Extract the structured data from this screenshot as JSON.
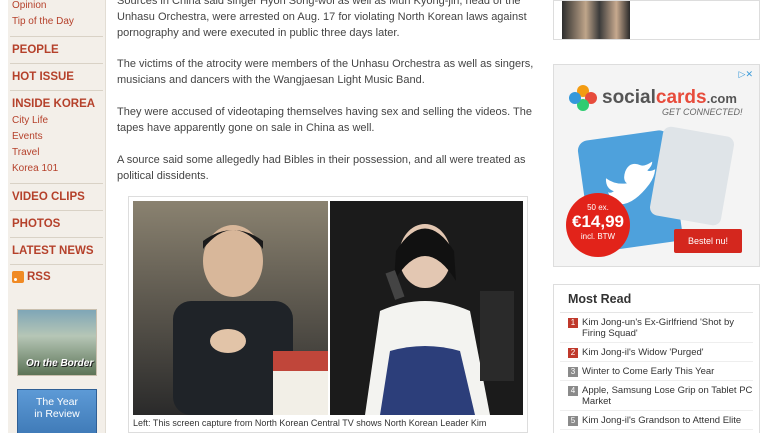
{
  "nav": {
    "top_links": [
      "Opinion",
      "Tip of the Day"
    ],
    "people": "PEOPLE",
    "hot_issue": "HOT ISSUE",
    "inside_korea": "INSIDE KOREA",
    "inside_korea_items": [
      "City Life",
      "Events",
      "Travel",
      "Korea 101"
    ],
    "video_clips": "VIDEO CLIPS",
    "photos": "PHOTOS",
    "latest_news": "LATEST NEWS",
    "rss": "RSS",
    "promo_border": "On the Border",
    "promo_year_line1": "The Year",
    "promo_year_line2": "in Review"
  },
  "article": {
    "para1": "Sources in China said singer Hyon Song-wol as well as Mun Kyong-jin, head of the Unhasu Orchestra, were arrested on Aug. 17 for violating North Korean laws against pornography and were executed in public three days later.",
    "para2": "The victims of the atrocity were members of the Unhasu Orchestra as well as singers, musicians and dancers with the Wangjaesan Light Music Band.",
    "para3": "They were accused of videotaping themselves having sex and selling the videos. The tapes have apparently gone on sale in China as well.",
    "para4": "A source said some allegedly had Bibles in their possession, and all were treated as political dissidents.",
    "caption": "Left: This screen capture from North Korean Central TV shows North Korean Leader Kim"
  },
  "ad": {
    "choices": "▷✕",
    "brand_a": "social",
    "brand_b": "cards",
    "brand_c": ".com",
    "slogan": "GET CONNECTED!",
    "price_top": "50 ex.",
    "price": "€14,99",
    "price_bottom": "incl. BTW",
    "order_button": "Bestel nu!"
  },
  "most_read": {
    "title": "Most Read",
    "items": [
      {
        "num": "1",
        "text": "Kim Jong-un's Ex-Girlfriend 'Shot by Firing Squad'"
      },
      {
        "num": "2",
        "text": "Kim Jong-il's Widow 'Purged'"
      },
      {
        "num": "3",
        "text": "Winter to Come Early This Year"
      },
      {
        "num": "4",
        "text": "Apple, Samsung Lose Grip on Tablet PC Market"
      },
      {
        "num": "5",
        "text": "Kim Jong-il's Grandson to Attend Elite"
      }
    ]
  },
  "colors": {
    "nav_red": "#b5412b",
    "most_read_top": "#c0392b",
    "most_read_other": "#8a8a8a"
  }
}
